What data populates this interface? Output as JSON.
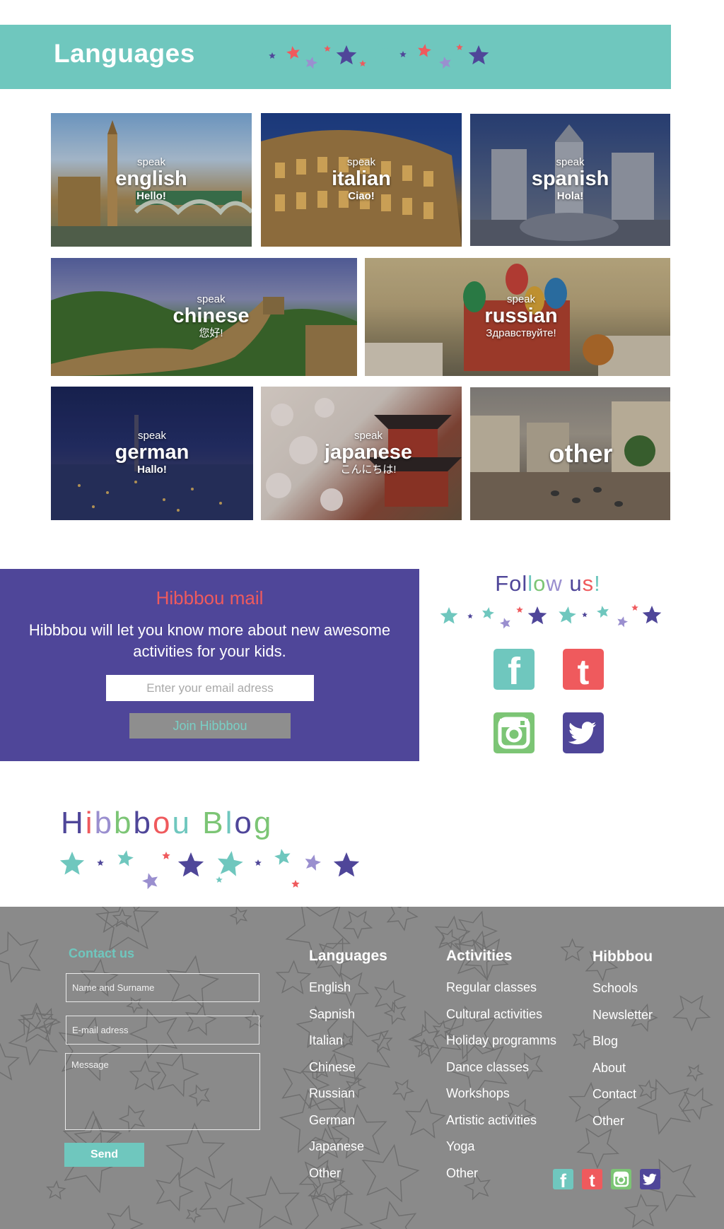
{
  "header": {
    "title": "Languages"
  },
  "languages": [
    {
      "speak": "speak",
      "name": "english",
      "greeting": "Hello!"
    },
    {
      "speak": "speak",
      "name": "italian",
      "greeting": "Ciao!"
    },
    {
      "speak": "speak",
      "name": "spanish",
      "greeting": "Hola!"
    },
    {
      "speak": "speak",
      "name": "chinese",
      "greeting": "您好!"
    },
    {
      "speak": "speak",
      "name": "russian",
      "greeting": "Здравствуйте!"
    },
    {
      "speak": "speak",
      "name": "german",
      "greeting": "Hallo!"
    },
    {
      "speak": "speak",
      "name": "japanese",
      "greeting": "こんにちは!"
    },
    {
      "name": "other"
    }
  ],
  "mail": {
    "title": "Hibbbou mail",
    "text": "Hibbbou will let you know more about new awesome activities for your kids.",
    "email_placeholder": "Enter your email adress",
    "join_label": "Join Hibbbou"
  },
  "follow": {
    "title": "Follow us!"
  },
  "blog": {
    "title": "Hibbbou Blog"
  },
  "footer": {
    "contact_title": "Contact us",
    "name_placeholder": "Name and Surname",
    "email_placeholder": "E-mail adress",
    "message_placeholder": "Message",
    "send_label": "Send",
    "columns": [
      {
        "title": "Languages",
        "items": [
          "English",
          "Sapnish",
          "Italian",
          "Chinese",
          "Russian",
          "German",
          "Japanese",
          "Other"
        ]
      },
      {
        "title": "Activities",
        "items": [
          "Regular classes",
          "Cultural activities",
          "Holiday programms",
          "Dance classes",
          "Workshops",
          "Artistic activities",
          "Yoga",
          "Other"
        ]
      },
      {
        "title": "Hibbbou",
        "items": [
          "Schools",
          "Newsletter",
          "Blog",
          "About",
          "Contact",
          "Other"
        ]
      }
    ]
  },
  "colors": {
    "teal": "#6fc7be",
    "purple": "#4f4699",
    "coral": "#ef5a5d",
    "green": "#7cc575",
    "lavender": "#9a8fcf",
    "footer_gray": "#8a8a8a"
  },
  "icons": [
    "facebook-icon",
    "tumblr-icon",
    "instagram-icon",
    "twitter-icon",
    "star-icon"
  ]
}
